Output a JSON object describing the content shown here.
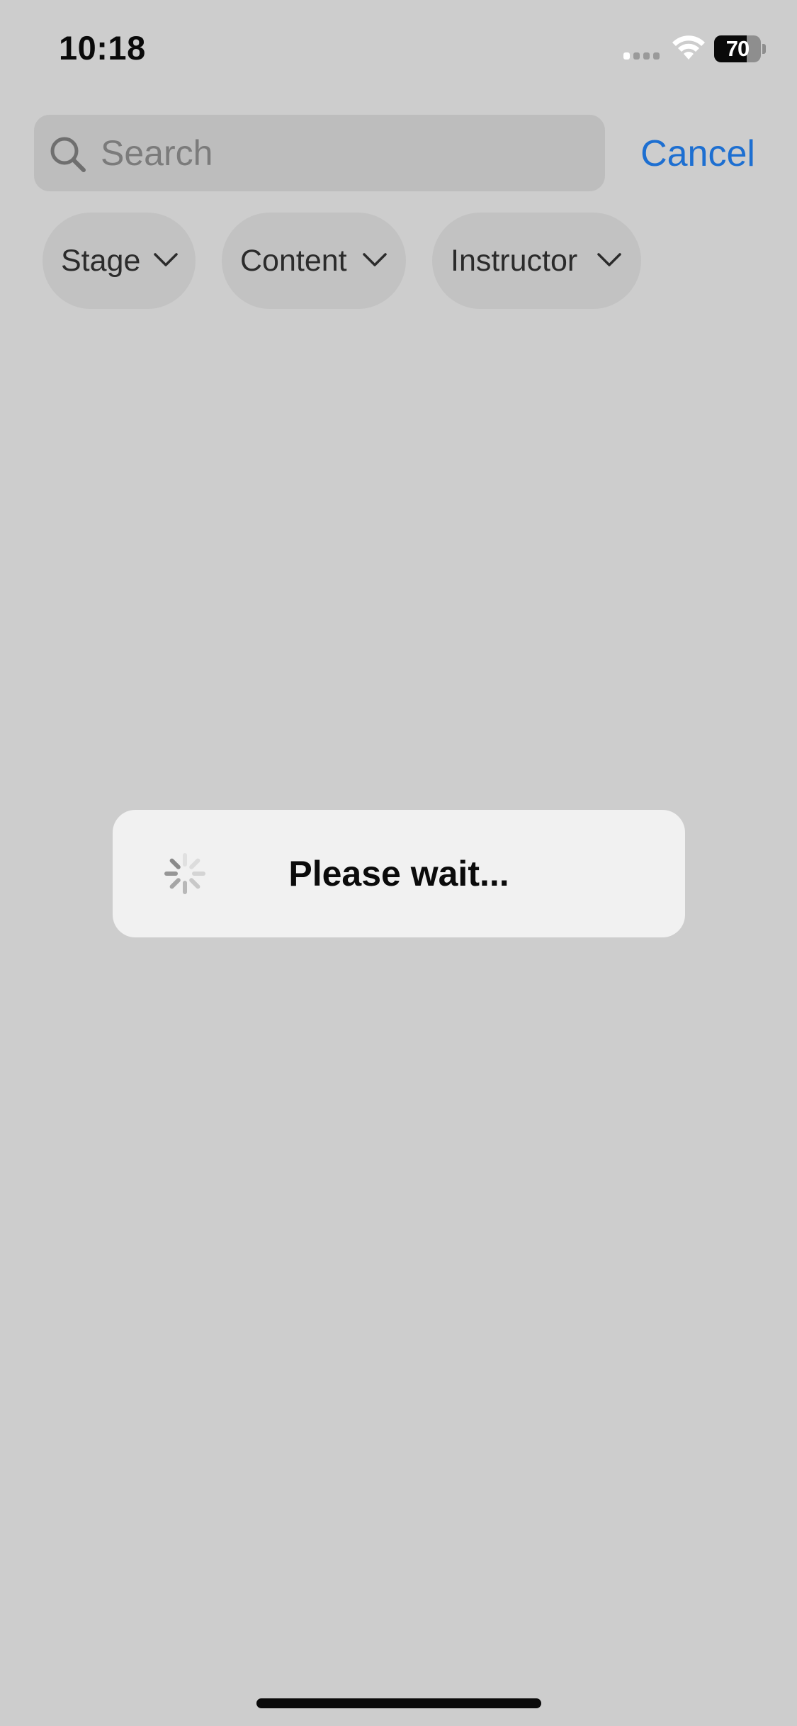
{
  "status_bar": {
    "time": "10:18",
    "battery_level": "70",
    "signal_bars_active": 1,
    "signal_bars_total": 4,
    "icons": [
      "signal-icon",
      "wifi-icon",
      "battery-icon"
    ]
  },
  "search": {
    "value": "",
    "placeholder": "Search",
    "cancel_label": "Cancel"
  },
  "filters": [
    {
      "label": "Stage",
      "icon": "chevron-down-icon"
    },
    {
      "label": "Content",
      "icon": "chevron-down-icon"
    },
    {
      "label": "Instructor",
      "icon": "chevron-down-icon"
    }
  ],
  "loading": {
    "message": "Please wait...",
    "icon": "spinner-icon"
  },
  "colors": {
    "background": "#cdcdcd",
    "search_field": "#bdbdbd",
    "chip": "#c2c2c2",
    "accent": "#1d6fd1",
    "dialog": "#f1f1f1"
  }
}
